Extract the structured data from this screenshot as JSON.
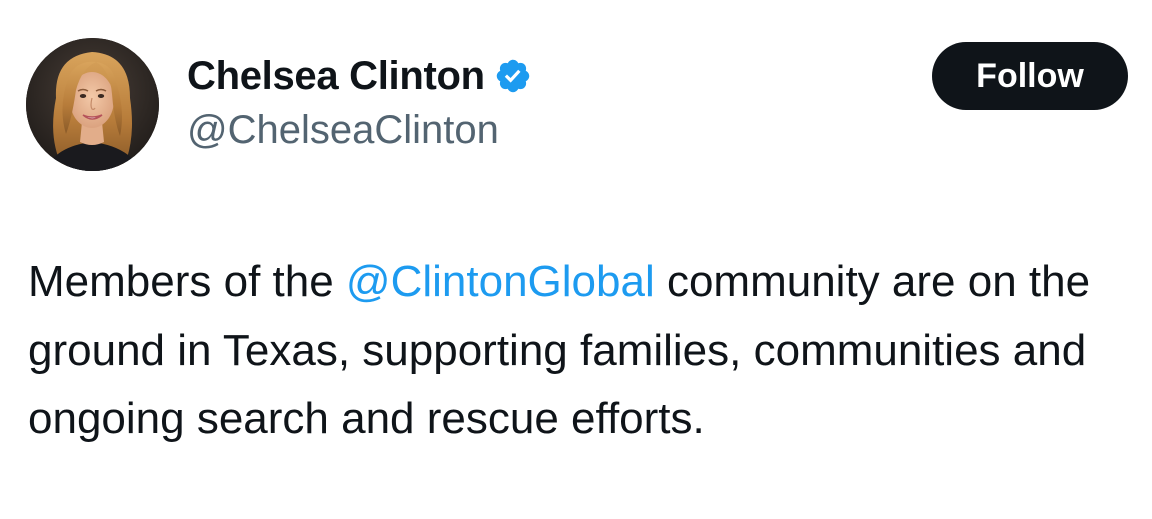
{
  "author": {
    "display_name": "Chelsea Clinton",
    "handle": "@ChelseaClinton",
    "verified": true,
    "verified_icon": "verified-badge-icon",
    "verified_color": "#1d9bf0"
  },
  "follow_button": {
    "label": "Follow"
  },
  "tweet": {
    "text_before": "Members of the ",
    "mention": "@ClintonGlobal",
    "text_after": " community are on the ground in Texas, supporting families, communities and ongoing search and rescue efforts."
  },
  "colors": {
    "text": "#0f1419",
    "secondary_text": "#536471",
    "link": "#1d9bf0",
    "button_bg": "#0f1419",
    "button_text": "#ffffff"
  }
}
